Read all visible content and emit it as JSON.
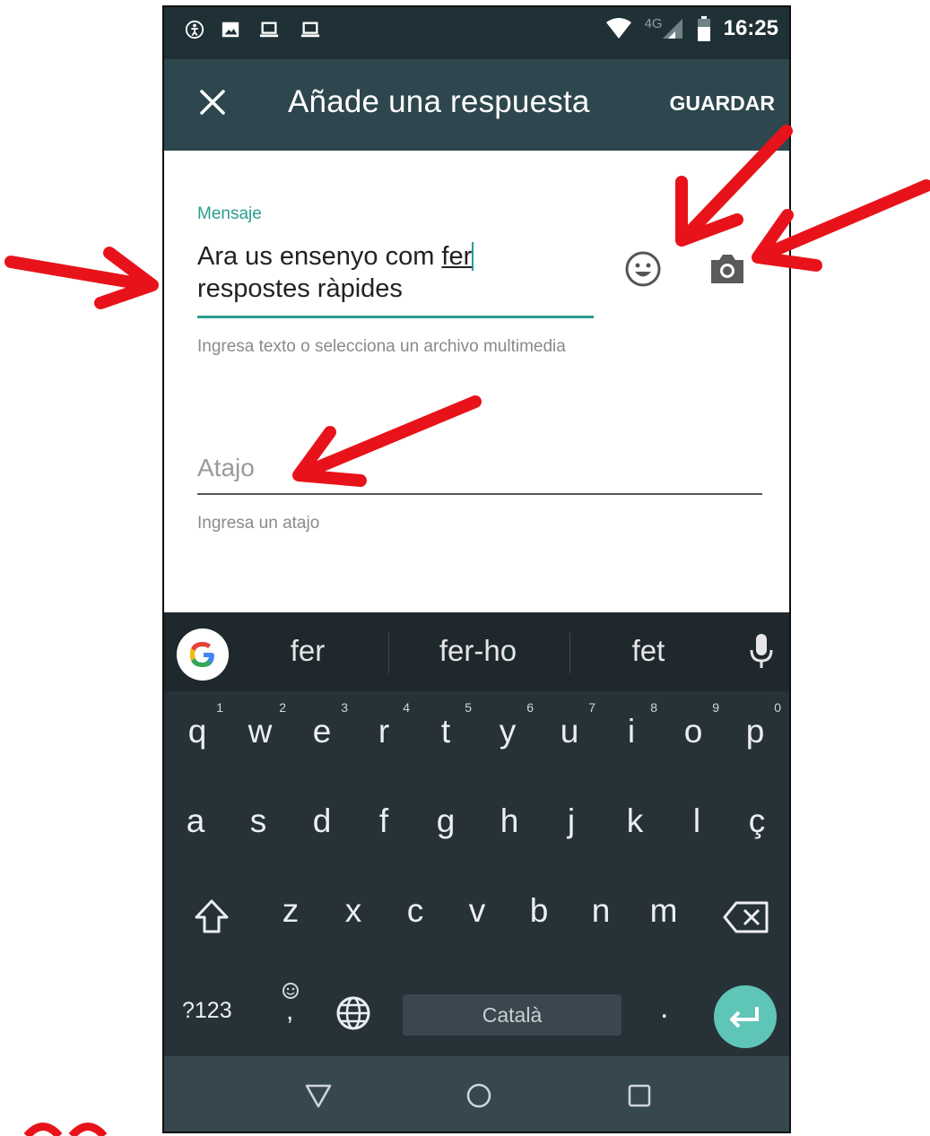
{
  "status_bar": {
    "time": "16:25",
    "network": "4G",
    "icons": [
      "accessibility-icon",
      "image-icon",
      "laptop-icon",
      "laptop-icon",
      "wifi-icon",
      "signal-icon",
      "battery-icon"
    ]
  },
  "toolbar": {
    "title": "Añade una respuesta",
    "save_label": "GUARDAR",
    "close_icon": "close-icon"
  },
  "form": {
    "message_label": "Mensaje",
    "message_line1": "Ara us ensenyo com ",
    "message_current_word": "fer",
    "message_line2": "respostes ràpides",
    "message_helper": "Ingresa texto o selecciona un archivo multimedia",
    "shortcut_placeholder": "Atajo",
    "shortcut_helper": "Ingresa un atajo",
    "emoji_icon": "emoji-icon",
    "camera_icon": "camera-icon"
  },
  "keyboard": {
    "suggestions": [
      "fer",
      "fer-ho",
      "fet"
    ],
    "row1": [
      {
        "key": "q",
        "hint": "1"
      },
      {
        "key": "w",
        "hint": "2"
      },
      {
        "key": "e",
        "hint": "3"
      },
      {
        "key": "r",
        "hint": "4"
      },
      {
        "key": "t",
        "hint": "5"
      },
      {
        "key": "y",
        "hint": "6"
      },
      {
        "key": "u",
        "hint": "7"
      },
      {
        "key": "i",
        "hint": "8"
      },
      {
        "key": "o",
        "hint": "9"
      },
      {
        "key": "p",
        "hint": "0"
      }
    ],
    "row2": [
      "a",
      "s",
      "d",
      "f",
      "g",
      "h",
      "j",
      "k",
      "l",
      "ç"
    ],
    "row3": [
      "z",
      "x",
      "c",
      "v",
      "b",
      "n",
      "m"
    ],
    "symbols_label": "?123",
    "comma_label": ",",
    "period_label": ".",
    "space_label": "Català",
    "accent_color": "#5fc5b7"
  },
  "colors": {
    "status_bar": "#1f3136",
    "toolbar": "#2e464e",
    "teal": "#2a9d8f",
    "arrow": "#e8131a"
  }
}
